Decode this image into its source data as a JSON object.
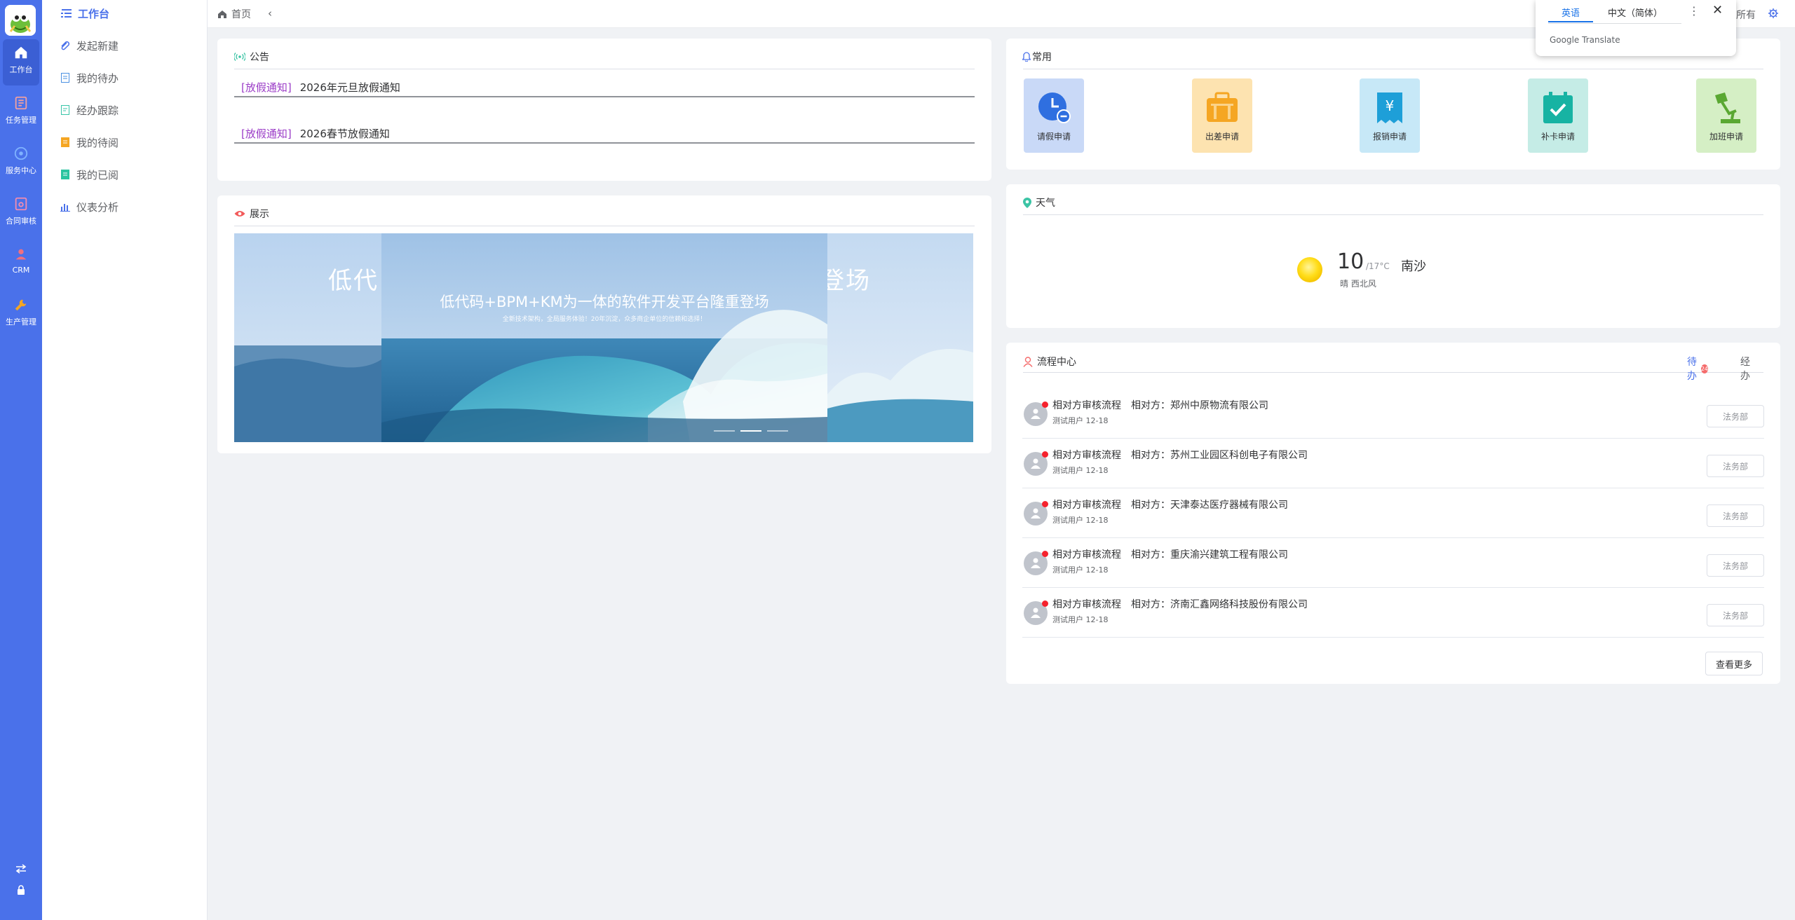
{
  "colors": {
    "primary": "#4a71ea",
    "notice_tag": "#9b3cc7",
    "badge": "#f56c6c"
  },
  "rail": {
    "items": [
      {
        "label": "工作台",
        "icon": "home-icon"
      },
      {
        "label": "任务管理",
        "icon": "task-list-icon"
      },
      {
        "label": "服务中心",
        "icon": "service-icon"
      },
      {
        "label": "合同审核",
        "icon": "contract-icon"
      },
      {
        "label": "CRM",
        "icon": "crm-user-icon"
      },
      {
        "label": "生产管理",
        "icon": "wrench-icon"
      }
    ]
  },
  "submenu": {
    "items": [
      {
        "label": "工作台",
        "icon": "list-icon"
      },
      {
        "label": "发起新建",
        "icon": "paperclip-icon"
      },
      {
        "label": "我的待办",
        "icon": "todo-doc-icon"
      },
      {
        "label": "经办跟踪",
        "icon": "track-doc-icon"
      },
      {
        "label": "我的待阅",
        "icon": "toread-doc-icon"
      },
      {
        "label": "我的已阅",
        "icon": "read-doc-icon"
      },
      {
        "label": "仪表分析",
        "icon": "bar-chart-icon"
      }
    ]
  },
  "header": {
    "breadcrumb": "首页",
    "right_text": "所有"
  },
  "translate": {
    "tab_source": "英语",
    "tab_target": "中文（简体）",
    "brand": "Google Translate"
  },
  "notice": {
    "title": "公告",
    "items": [
      {
        "tag": "[放假通知]",
        "text": "2026年元旦放假通知"
      },
      {
        "tag": "[放假通知]",
        "text": "2026春节放假通知"
      }
    ]
  },
  "showcase": {
    "title": "展示",
    "left_peek": "低代",
    "right_peek": "登场",
    "slide_title": "低代码+BPM+KM为一体的软件开发平台隆重登场",
    "slide_subtitle": "全新技术架构，全局服务体验！20年沉淀，众多商企单位的信赖和选择！"
  },
  "common": {
    "title": "常用",
    "apps": [
      {
        "label": "请假申请",
        "icon": "clock-icon",
        "bg": "#c9d9f7",
        "fg": "#2f6fe0"
      },
      {
        "label": "出差申请",
        "icon": "briefcase-icon",
        "bg": "#fde3b0",
        "fg": "#f5a623"
      },
      {
        "label": "报销申请",
        "icon": "receipt-icon",
        "bg": "#c7e8f7",
        "fg": "#1e9fd8"
      },
      {
        "label": "补卡申请",
        "icon": "calendar-check-icon",
        "bg": "#c5ece6",
        "fg": "#17b3a3"
      },
      {
        "label": "加班申请",
        "icon": "desk-lamp-icon",
        "bg": "#d5efc5",
        "fg": "#5aa832"
      }
    ]
  },
  "weather": {
    "title": "天气",
    "temp": "10",
    "range": "/17°C",
    "city": "南沙",
    "desc": "晴 西北风"
  },
  "process": {
    "title": "流程中心",
    "tab_todo": "待办",
    "tab_todo_count": "24",
    "tab_done": "经办",
    "rows": [
      {
        "name": "相对方审核流程",
        "party": "相对方：郑州中原物流有限公司",
        "meta": "测试用户 12-18",
        "dept": "法务部"
      },
      {
        "name": "相对方审核流程",
        "party": "相对方：苏州工业园区科创电子有限公司",
        "meta": "测试用户 12-18",
        "dept": "法务部"
      },
      {
        "name": "相对方审核流程",
        "party": "相对方：天津泰达医疗器械有限公司",
        "meta": "测试用户 12-18",
        "dept": "法务部"
      },
      {
        "name": "相对方审核流程",
        "party": "相对方：重庆渝兴建筑工程有限公司",
        "meta": "测试用户 12-18",
        "dept": "法务部"
      },
      {
        "name": "相对方审核流程",
        "party": "相对方：济南汇鑫网络科技股份有限公司",
        "meta": "测试用户 12-18",
        "dept": "法务部"
      }
    ],
    "more": "查看更多"
  }
}
